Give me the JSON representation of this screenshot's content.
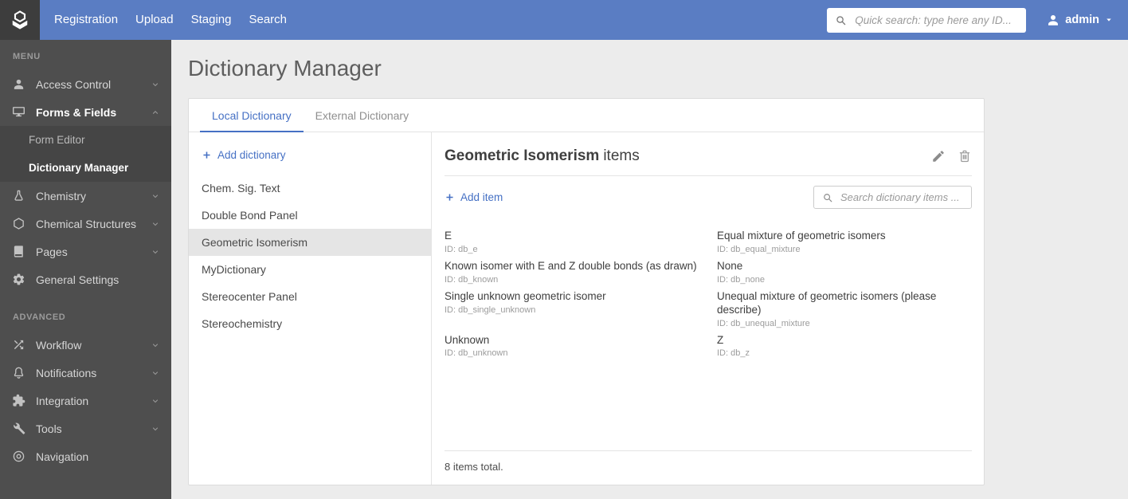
{
  "colors": {
    "topbar_blue": "#5a7dc3",
    "accent_blue": "#4570c4",
    "sidebar_bg": "#4e4e4e",
    "submenu_bg": "#454545",
    "logo_bg": "#3d3d3d",
    "selected_row": "#e5e5e5"
  },
  "topbar": {
    "nav": [
      {
        "label": "Registration"
      },
      {
        "label": "Upload"
      },
      {
        "label": "Staging"
      },
      {
        "label": "Search"
      }
    ],
    "search": {
      "placeholder": "Quick search: type here any ID...",
      "value": ""
    },
    "user": {
      "name": "admin"
    }
  },
  "sidebar": {
    "sections": [
      {
        "header": "MENU",
        "items": [
          {
            "label": "Access Control",
            "icon": "user",
            "chevron": "down"
          },
          {
            "label": "Forms & Fields",
            "icon": "monitor",
            "chevron": "up",
            "bold": true,
            "submenu": [
              {
                "label": "Form Editor"
              },
              {
                "label": "Dictionary Manager",
                "active": true
              }
            ]
          },
          {
            "label": "Chemistry",
            "icon": "flask",
            "chevron": "down"
          },
          {
            "label": "Chemical Structures",
            "icon": "hexagon",
            "chevron": "down"
          },
          {
            "label": "Pages",
            "icon": "book",
            "chevron": "down"
          },
          {
            "label": "General Settings",
            "icon": "gear"
          }
        ]
      },
      {
        "header": "ADVANCED",
        "items": [
          {
            "label": "Workflow",
            "icon": "shuffle",
            "chevron": "down"
          },
          {
            "label": "Notifications",
            "icon": "bell",
            "chevron": "down"
          },
          {
            "label": "Integration",
            "icon": "puzzle",
            "chevron": "down"
          },
          {
            "label": "Tools",
            "icon": "wrench",
            "chevron": "down"
          },
          {
            "label": "Navigation",
            "icon": "compass"
          }
        ]
      }
    ]
  },
  "main": {
    "title": "Dictionary Manager",
    "tabs": [
      {
        "label": "Local Dictionary",
        "active": true
      },
      {
        "label": "External Dictionary",
        "active": false
      }
    ],
    "dictionaries": {
      "add_label": "Add dictionary",
      "items": [
        {
          "name": "Chem. Sig. Text"
        },
        {
          "name": "Double Bond Panel"
        },
        {
          "name": "Geometric Isomerism",
          "selected": true
        },
        {
          "name": "MyDictionary"
        },
        {
          "name": "Stereocenter Panel"
        },
        {
          "name": "Stereochemistry"
        }
      ]
    },
    "detail": {
      "title_bold": "Geometric Isomerism",
      "title_rest": "items",
      "add_label": "Add item",
      "search_placeholder": "Search dictionary items ...",
      "search_value": "",
      "items": [
        {
          "label": "E",
          "id_text": "ID: db_e"
        },
        {
          "label": "Equal mixture of geometric isomers",
          "id_text": "ID: db_equal_mixture"
        },
        {
          "label": "Known isomer with E and Z double bonds (as drawn)",
          "id_text": "ID: db_known"
        },
        {
          "label": "None",
          "id_text": "ID: db_none"
        },
        {
          "label": "Single unknown geometric isomer",
          "id_text": "ID: db_single_unknown"
        },
        {
          "label": "Unequal mixture of geometric isomers (please describe)",
          "id_text": "ID: db_unequal_mixture"
        },
        {
          "label": "Unknown",
          "id_text": "ID: db_unknown"
        },
        {
          "label": "Z",
          "id_text": "ID: db_z"
        }
      ],
      "footer": "8 items total."
    }
  }
}
